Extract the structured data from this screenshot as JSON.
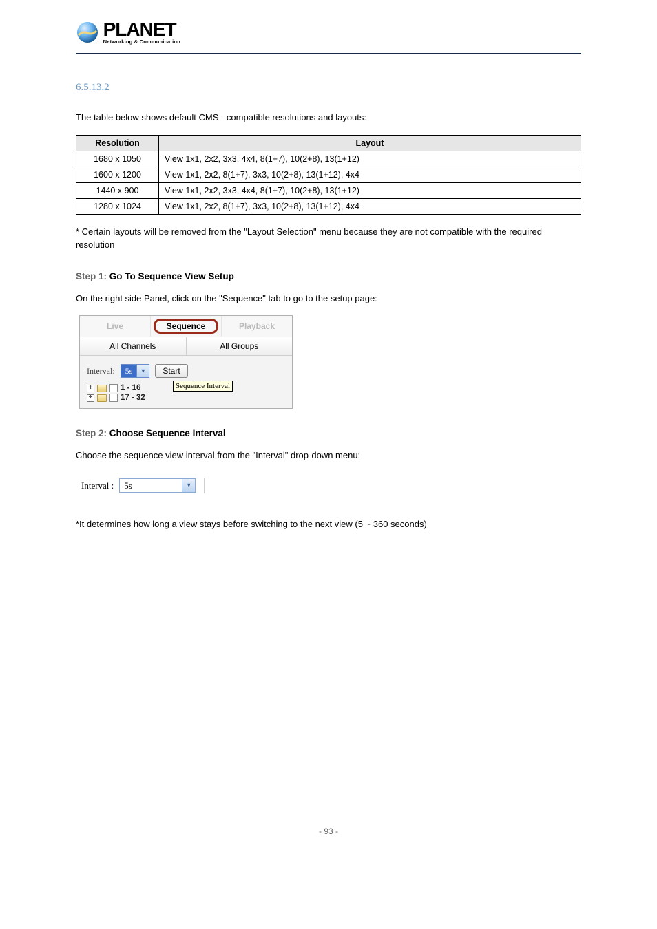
{
  "logo": {
    "name": "PLANET",
    "sub": "Networking & Communication"
  },
  "section_label": "6.5.13.2",
  "intro": "The table below shows default CMS - compatible resolutions and layouts:",
  "table": {
    "headers": [
      "Resolution",
      "Layout"
    ],
    "rows": [
      [
        "1680 x 1050",
        "View 1x1, 2x2, 3x3, 4x4, 8(1+7), 10(2+8), 13(1+12)"
      ],
      [
        "1600 x 1200",
        "View 1x1, 2x2, 8(1+7), 3x3, 10(2+8), 13(1+12), 4x4"
      ],
      [
        "1440 x 900",
        "View 1x1, 2x2, 3x3, 4x4, 8(1+7), 10(2+8), 13(1+12)"
      ],
      [
        "1280 x 1024",
        "View 1x1, 2x2, 8(1+7), 3x3, 10(2+8), 13(1+12), 4x4"
      ]
    ]
  },
  "step1": {
    "heading_num": "Step 1:",
    "heading_text": "Go To Sequence View Setup",
    "p1": "On the right side Panel, click on the \"Sequence\" tab to go to the setup page:",
    "p2": "* Certain layouts will be removed from the \"Layout Selection\" menu because they are not compatible with the required resolution",
    "ui": {
      "tabs": [
        "Live",
        "Sequence",
        "Playback"
      ],
      "subtabs": [
        "All Channels",
        "All Groups"
      ],
      "interval_label": "Interval:",
      "interval_value": "5s",
      "start": "Start",
      "tooltip": "Sequence Interval",
      "tree": [
        "1 - 16",
        "17 - 32"
      ]
    }
  },
  "step2": {
    "heading_num": "Step 2:",
    "heading_text": "Choose Sequence Interval",
    "p1": "Choose the sequence view interval from the \"Interval\" drop-down menu:",
    "interval_label": "Interval :",
    "interval_value": "5s",
    "p2": "*It determines how long a view stays before switching to the next view (5 ~ 360 seconds)"
  },
  "page_number": "- 93 -"
}
